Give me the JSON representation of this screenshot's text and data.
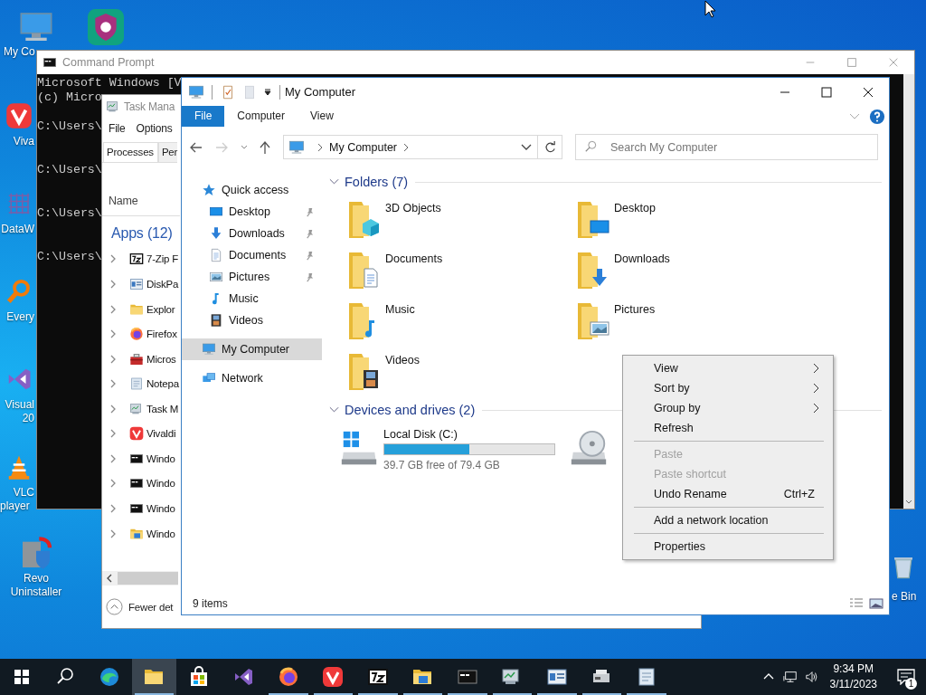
{
  "desktop": {
    "icons": [
      {
        "kind": "computer",
        "label_lines": [
          "My Co"
        ]
      },
      {
        "kind": "vivaldi",
        "label_lines": [
          "Viva"
        ]
      },
      {
        "kind": "grid",
        "label_lines": [
          "DataW"
        ]
      },
      {
        "kind": "magnifier",
        "label_lines": [
          "Every"
        ]
      },
      {
        "kind": "vs",
        "label_lines": [
          "Visual",
          "20"
        ]
      },
      {
        "kind": "cone",
        "label_lines": [
          "VLC",
          "player"
        ]
      },
      {
        "kind": "revo",
        "label_lines": [
          "Revo",
          "Uninstaller"
        ]
      }
    ],
    "second_icon": {
      "kind": "shield"
    },
    "bin": {
      "kind": "bin",
      "label": "e Bin"
    }
  },
  "cmd": {
    "title": "Command Prompt",
    "lines": [
      {
        "kind": "banner",
        "text": "Microsoft Windows [V"
      },
      {
        "kind": "banner",
        "text": "(c) Micro"
      },
      {
        "kind": "prompt",
        "text": "C:\\Users\\"
      },
      {
        "kind": "prompt",
        "text": "C:\\Users\\"
      },
      {
        "kind": "prompt",
        "text": "C:\\Users\\"
      },
      {
        "kind": "prompt",
        "text": "C:\\Users\\"
      }
    ]
  },
  "task_manager": {
    "title": "Task Mana",
    "menu": [
      "File",
      "Options"
    ],
    "tabs": [
      {
        "label": "Processes",
        "selected": true
      },
      {
        "label": "Per",
        "selected": false
      }
    ],
    "column": "Name",
    "group": "Apps (12)",
    "rows": [
      {
        "label": "7-Zip F",
        "kind": "sevenzip"
      },
      {
        "label": "DiskPa",
        "kind": "diskpart"
      },
      {
        "label": "Explor",
        "kind": "folder"
      },
      {
        "label": "Firefox",
        "kind": "firefox"
      },
      {
        "label": "Micros",
        "kind": "toolbox"
      },
      {
        "label": "Notepa",
        "kind": "notepad"
      },
      {
        "label": "Task M",
        "kind": "taskmgr"
      },
      {
        "label": "Vivaldi",
        "kind": "vivaldi"
      },
      {
        "label": "Windo",
        "kind": "console"
      },
      {
        "label": "Windo",
        "kind": "console"
      },
      {
        "label": "Windo",
        "kind": "console"
      },
      {
        "label": "Windo",
        "kind": "winfolder"
      }
    ],
    "toggle": "Fewer det"
  },
  "explorer": {
    "title": "My Computer",
    "ribbon_tabs": [
      {
        "label": "File",
        "selected": true
      },
      {
        "label": "Computer",
        "selected": false
      },
      {
        "label": "View",
        "selected": false
      }
    ],
    "address": "My Computer",
    "search": {
      "placeholder": "Search My Computer"
    },
    "nav": [
      {
        "label": "Quick access",
        "kind": "star",
        "selected": false,
        "children": [
          {
            "label": "Desktop",
            "kind": "desktop",
            "pinned": true,
            "selected": false
          },
          {
            "label": "Downloads",
            "kind": "download",
            "pinned": true,
            "selected": false
          },
          {
            "label": "Documents",
            "kind": "document",
            "pinned": true,
            "selected": false
          },
          {
            "label": "Pictures",
            "kind": "picture",
            "pinned": true,
            "selected": false
          },
          {
            "label": "Music",
            "kind": "music",
            "pinned": false,
            "selected": false
          },
          {
            "label": "Videos",
            "kind": "video",
            "pinned": false,
            "selected": false
          }
        ]
      },
      {
        "label": "My Computer",
        "kind": "computer",
        "selected": true
      },
      {
        "label": "Network",
        "kind": "network",
        "selected": false
      }
    ],
    "folders": {
      "title": "Folders (7)",
      "expanded": true,
      "items": [
        {
          "label": "3D Objects",
          "kind": "cube"
        },
        {
          "label": "Desktop",
          "kind": "desktop"
        },
        {
          "label": "Documents",
          "kind": "document"
        },
        {
          "label": "Downloads",
          "kind": "download"
        },
        {
          "label": "Music",
          "kind": "music"
        },
        {
          "label": "Pictures",
          "kind": "picture"
        },
        {
          "label": "Videos",
          "kind": "video"
        }
      ]
    },
    "drives": {
      "title": "Devices and drives (2)",
      "expanded": true,
      "items": [
        {
          "kind": "windows",
          "label": "Local Disk (C:)",
          "level": 0.5,
          "free": "39.7 GB free of 79.4 GB"
        },
        {
          "kind": "disc"
        }
      ]
    },
    "status": "9 items"
  },
  "context_menu": {
    "items": [
      {
        "kind": "item",
        "label": "View",
        "submenu": true,
        "disabled": false
      },
      {
        "kind": "item",
        "label": "Sort by",
        "submenu": true,
        "disabled": false
      },
      {
        "kind": "item",
        "label": "Group by",
        "submenu": true,
        "disabled": false
      },
      {
        "kind": "item",
        "label": "Refresh",
        "submenu": false,
        "disabled": false
      },
      {
        "kind": "separator"
      },
      {
        "kind": "item",
        "label": "Paste",
        "submenu": false,
        "disabled": true
      },
      {
        "kind": "item",
        "label": "Paste shortcut",
        "submenu": false,
        "disabled": true
      },
      {
        "kind": "item",
        "label": "Undo Rename",
        "shortcut": "Ctrl+Z",
        "submenu": false,
        "disabled": false
      },
      {
        "kind": "separator"
      },
      {
        "kind": "item",
        "label": "Add a network location",
        "submenu": false,
        "disabled": false
      },
      {
        "kind": "separator"
      },
      {
        "kind": "item",
        "label": "Properties",
        "submenu": false,
        "disabled": false
      }
    ]
  },
  "taskbar": {
    "apps": [
      {
        "kind": "edge",
        "selected": false,
        "running": false
      },
      {
        "kind": "folder",
        "selected": true,
        "running": true
      },
      {
        "kind": "store",
        "selected": false,
        "running": false
      },
      {
        "kind": "vs",
        "selected": false,
        "running": false
      },
      {
        "kind": "firefox",
        "selected": false,
        "running": true
      },
      {
        "kind": "vivaldi",
        "selected": false,
        "running": true
      },
      {
        "kind": "sevenzip",
        "selected": false,
        "running": true
      },
      {
        "kind": "winfolder",
        "selected": false,
        "running": true
      },
      {
        "kind": "console",
        "selected": false,
        "running": true
      },
      {
        "kind": "taskmgr",
        "selected": false,
        "running": true
      },
      {
        "kind": "diskpart",
        "selected": false,
        "running": true
      },
      {
        "kind": "device",
        "selected": false,
        "running": true
      },
      {
        "kind": "notepad",
        "selected": false,
        "running": true
      }
    ],
    "time": "9:34 PM",
    "date": "3/11/2023",
    "notification_count": "1"
  }
}
